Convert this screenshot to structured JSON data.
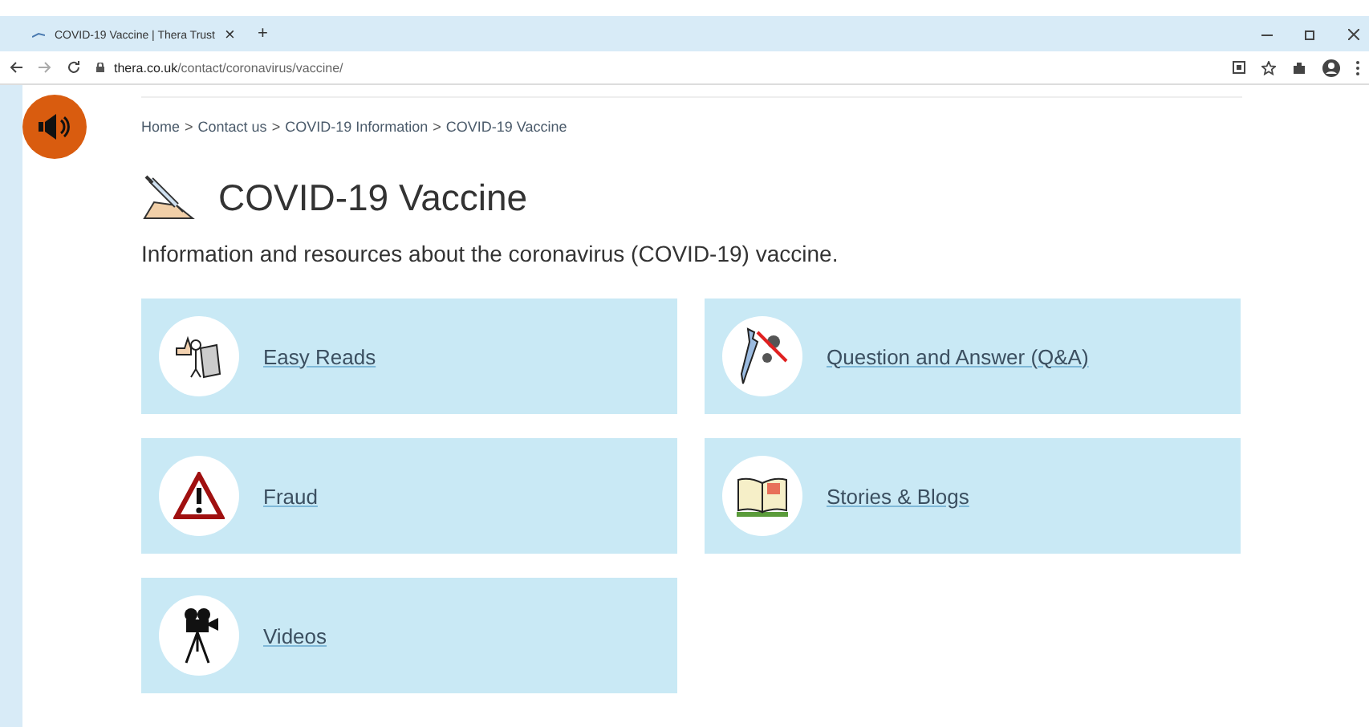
{
  "browser": {
    "tab_title": "COVID-19 Vaccine | Thera Trust",
    "tab_close": "×",
    "new_tab": "+",
    "url_domain": "thera.co.uk",
    "url_path": "/contact/coronavirus/vaccine/"
  },
  "breadcrumb": [
    {
      "label": "Home"
    },
    {
      "label": "Contact us"
    },
    {
      "label": "COVID-19 Information"
    },
    {
      "label": "COVID-19 Vaccine"
    }
  ],
  "breadcrumb_separator": ">",
  "title": "COVID-19 Vaccine",
  "intro": "Information and resources about the coronavirus (COVID-19) vaccine.",
  "cards": [
    {
      "label": "Easy Reads",
      "kind": "reading"
    },
    {
      "label": "Question and Answer (Q&A)",
      "kind": "syringe"
    },
    {
      "label": "Fraud",
      "kind": "warning"
    },
    {
      "label": "Stories & Blogs",
      "kind": "book"
    },
    {
      "label": "Videos",
      "kind": "camera"
    }
  ]
}
